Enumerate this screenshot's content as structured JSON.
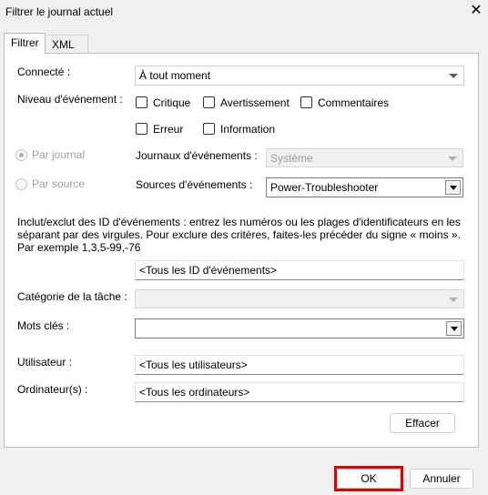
{
  "window": {
    "title": "Filtrer le journal actuel"
  },
  "tabs": [
    {
      "label": "Filtrer"
    },
    {
      "label": "XML"
    }
  ],
  "form": {
    "connecte_label": "Connecté :",
    "connecte_value": "À tout moment",
    "niveau_label": "Niveau d'événement :",
    "levels": [
      {
        "label": "Critique",
        "checked": false
      },
      {
        "label": "Avertissement",
        "checked": false
      },
      {
        "label": "Commentaires",
        "checked": false
      },
      {
        "label": "Erreur",
        "checked": false
      },
      {
        "label": "Information",
        "checked": false
      }
    ],
    "par_journal_label": "Par journal",
    "par_source_label": "Par source",
    "journaux_label": "Journaux d'événements :",
    "journaux_value": "Système",
    "sources_label": "Sources d'événements :",
    "sources_value": "Power-Troubleshooter",
    "id_description": "Inclut/exclut des ID d'événements : entrez les numéros ou les plages d'identificateurs en les séparant par des virgules. Pour exclure des critères, faites-les précéder du signe « moins ». Par exemple 1,3,5-99,-76",
    "id_value": "<Tous les ID d'événements>",
    "categorie_label": "Catégorie de la tâche :",
    "categorie_value": "",
    "mots_cles_label": "Mots clés :",
    "mots_cles_value": "",
    "utilisateur_label": "Utilisateur :",
    "utilisateur_value": "<Tous les utilisateurs>",
    "ordinateur_label": "Ordinateur(s) :",
    "ordinateur_value": "<Tous les ordinateurs>",
    "effacer_label": "Effacer"
  },
  "footer": {
    "ok_label": "OK",
    "annuler_label": "Annuler"
  },
  "colors": {
    "highlight": "#e00000"
  }
}
